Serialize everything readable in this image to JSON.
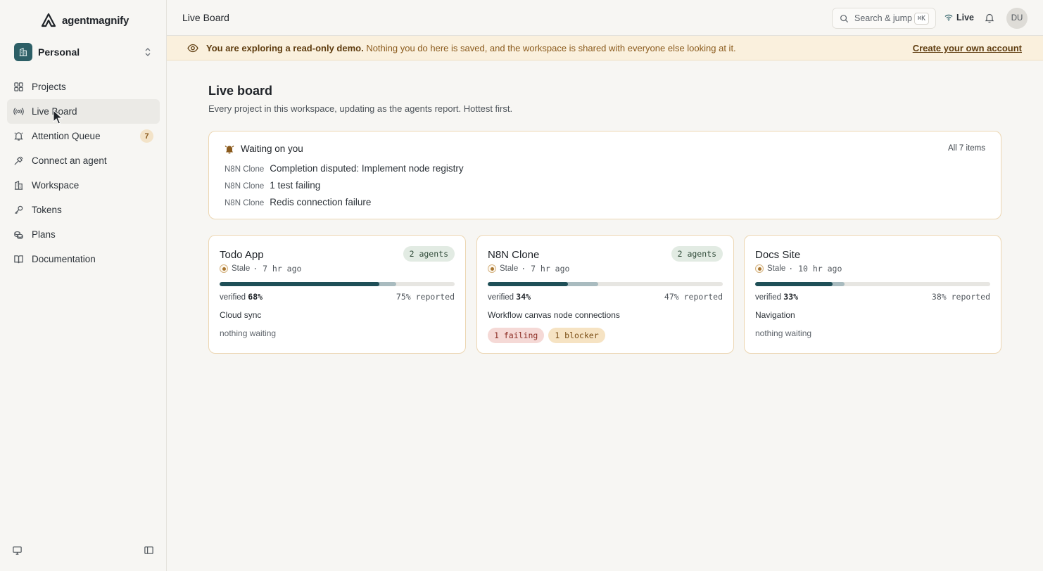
{
  "brand": {
    "name": "agentmagnify"
  },
  "workspace": {
    "name": "Personal"
  },
  "sidebar": {
    "items": [
      {
        "label": "Projects",
        "icon": "grid-icon"
      },
      {
        "label": "Live Board",
        "icon": "broadcast-icon",
        "active": true
      },
      {
        "label": "Attention Queue",
        "icon": "bell-icon",
        "badge": "7"
      },
      {
        "label": "Connect an agent",
        "icon": "plug-icon"
      },
      {
        "label": "Workspace",
        "icon": "building-icon"
      },
      {
        "label": "Tokens",
        "icon": "key-icon"
      },
      {
        "label": "Plans",
        "icon": "coins-icon"
      },
      {
        "label": "Documentation",
        "icon": "book-icon"
      }
    ]
  },
  "topbar": {
    "title": "Live Board",
    "search_label": "Search & jump",
    "search_shortcut": "⌘K",
    "live_label": "Live",
    "user_initials": "DU"
  },
  "banner": {
    "strong": "You are exploring a read-only demo.",
    "rest": " Nothing you do here is saved, and the workspace is shared with everyone else looking at it.",
    "link": "Create your own account"
  },
  "page": {
    "title": "Live board",
    "subtitle": "Every project in this workspace, updating as the agents report. Hottest first."
  },
  "waiting": {
    "title": "Waiting on you",
    "all_link": "All 7 items",
    "items": [
      {
        "project": "N8N Clone",
        "text": "Completion disputed: Implement node registry"
      },
      {
        "project": "N8N Clone",
        "text": "1 test failing"
      },
      {
        "project": "N8N Clone",
        "text": "Redis connection failure"
      }
    ]
  },
  "cards": [
    {
      "title": "Todo App",
      "agents": "2 agents",
      "status": "Stale",
      "ago": "· 7 hr ago",
      "verified_label": "verified",
      "verified": "68%",
      "verified_pct": 68,
      "reported": "75% reported",
      "reported_pct": 75,
      "task": "Cloud sync",
      "waiting": "nothing waiting"
    },
    {
      "title": "N8N Clone",
      "agents": "2 agents",
      "status": "Stale",
      "ago": "· 7 hr ago",
      "verified_label": "verified",
      "verified": "34%",
      "verified_pct": 34,
      "reported": "47% reported",
      "reported_pct": 47,
      "task": "Workflow canvas node connections",
      "failing": "1 failing",
      "blocker": "1 blocker"
    },
    {
      "title": "Docs Site",
      "agents": "",
      "status": "Stale",
      "ago": "· 10 hr ago",
      "verified_label": "verified",
      "verified": "33%",
      "verified_pct": 33,
      "reported": "38% reported",
      "reported_pct": 38,
      "task": "Navigation",
      "waiting": "nothing waiting"
    }
  ],
  "colors": {
    "accent": "#1f4f57",
    "warning_bg": "#faf0dd",
    "card_border": "#ecd6b2"
  }
}
